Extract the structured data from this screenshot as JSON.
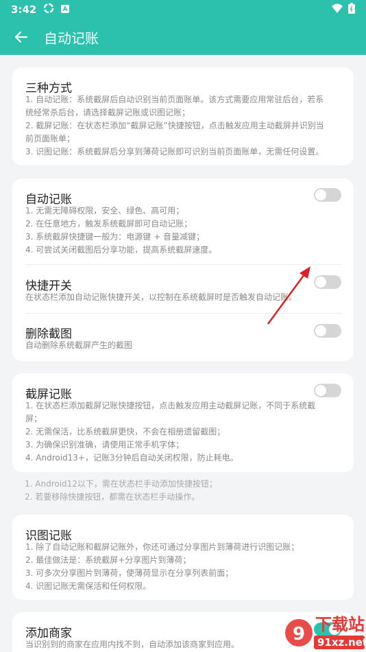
{
  "status": {
    "time": "3:42"
  },
  "appbar": {
    "title": "自动记账",
    "back_icon": "arrow-left-icon"
  },
  "colors": {
    "accent": "#2bc1ad",
    "annotation": "#e02020"
  },
  "card_modes": {
    "title": "三种方式",
    "text": "1. 自动记账：系统截屏后自动识别当前页面账单。该方式需要应用常驻后台，若系\n统经常杀后台，请选择截屏记账或识图记账；\n2. 截屏记账：在状态栏添加“截屏记账”快捷按钮，点击触发应用主动截屏并识别当\n前页面账单；\n3. 识图记账：系统截屏后分享到薄荷记账即可识别当前页面账单，无需任何设置。"
  },
  "card_auto": {
    "auto": {
      "title": "自动记账",
      "text": "1. 无需无障碍权限，安全、绿色、高可用；\n2. 在任意地方，触发系统截屏即可自动记账；\n3. 系统截屏快捷键一般为：电源键 + 音量减键；\n4. 可尝试关闭截图后分享功能，提高系统截屏速度。",
      "enabled": false
    },
    "shortcut": {
      "title": "快捷开关",
      "text": "在状态栏添加自动记账快捷开关，以控制在系统截屏时是否触发自动记账。",
      "enabled": false
    },
    "delete_shot": {
      "title": "删除截图",
      "text": "自动删除系统截屏产生的截图",
      "enabled": false
    }
  },
  "card_screenshot": {
    "title": "截屏记账",
    "text": "1. 在状态栏添加截屏记账快捷按钮，点击触发应用主动截屏记账，不同于系统截\n屏；\n2. 无需保活，比系统截屏更快，不会在相册遗留截图；\n3. 为确保识别准确，请使用正常手机字体；\n4. Android13+，记账3分钟后自动关闭权限，防止耗电。",
    "enabled": false
  },
  "note": "1. Android12以下，需在状态栏手动添加快捷按钮；\n2. 若要移除快捷按钮，都需在状态栏手动操作。",
  "card_image": {
    "title": "识图记账",
    "text": "1. 除了自动记账和截屏记账外，你还可通过分享图片到薄荷进行识图记账；\n2. 最佳做法是：系统截屏+分享图片到薄荷；\n3. 可多次分享图片到薄荷，使薄荷显示在分享列表前面；\n4. 识图记账无需保活和任何权限。"
  },
  "card_merchant": {
    "title": "添加商家",
    "text": "当识别到的商家在应用内找不到，自动添加该商家到应用。",
    "enabled": true
  },
  "watermark": {
    "line1": "下载站",
    "line2": "91xz.net"
  }
}
